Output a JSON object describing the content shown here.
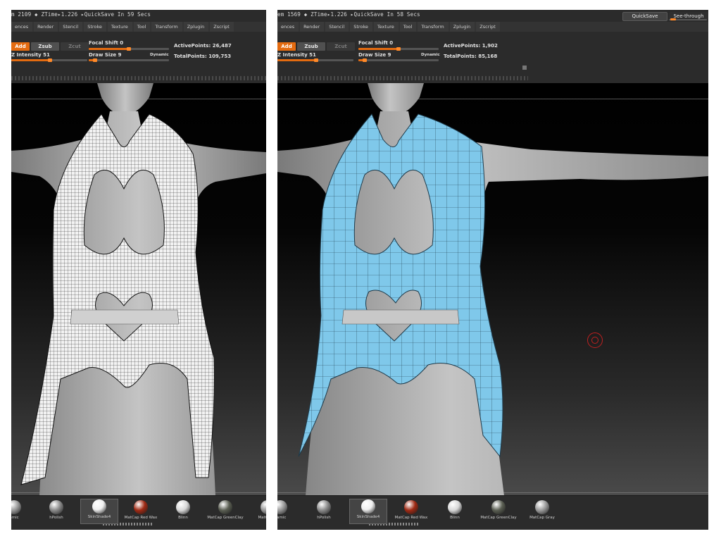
{
  "left_panel": {
    "status": "m 2109 ◆ ZTime▸1.226 ▸QuickSave In 59 Secs",
    "menu": [
      "ences",
      "Render",
      "Stencil",
      "Stroke",
      "Texture",
      "Tool",
      "Transform",
      "Zplugin",
      "Zscript"
    ],
    "modes": {
      "add": "Add",
      "zsub": "Zsub",
      "zcut": "Zcut"
    },
    "z_intensity_label": "Z Intensity 51",
    "focal_shift_label": "Focal Shift 0",
    "draw_size_label": "Draw Size 9",
    "dynamic_label": "Dynamic",
    "active_points_label": "ActivePoints: 26,487",
    "total_points_label": "TotalPoints: 109,753",
    "z_intensity_fraction": 0.51,
    "focal_shift_fraction": 0.5,
    "draw_size_fraction": 0.08,
    "materials": [
      {
        "label": "amic",
        "color": "#9a9a9a",
        "icon": "material-sphere-icon"
      },
      {
        "label": "hPolish",
        "color": "#8a8a8a",
        "icon": "material-sphere-icon"
      },
      {
        "label": "SkinShade4",
        "color": "#f0f0f0",
        "icon": "material-sphere-icon",
        "selected": true
      },
      {
        "label": "MatCap Red Wax",
        "color": "#a02a14",
        "icon": "material-sphere-icon"
      },
      {
        "label": "Blinn",
        "color": "#d8d8d8",
        "icon": "material-sphere-icon"
      },
      {
        "label": "MatCap GreenClay",
        "color": "#5a5e52",
        "icon": "material-sphere-icon"
      },
      {
        "label": "MatCap G",
        "color": "#9a9a9a",
        "icon": "material-sphere-icon"
      }
    ]
  },
  "right_panel": {
    "status": "em 1569 ◆ ZTime▸1.226 ▸QuickSave In 58 Secs",
    "menu": [
      "ences",
      "Render",
      "Stencil",
      "Stroke",
      "Texture",
      "Tool",
      "Transform",
      "Zplugin",
      "Zscript"
    ],
    "quicksave_label": "QuickSave",
    "see_through_label": "See-through",
    "see_through_fraction": 0.1,
    "modes": {
      "add": "Add",
      "zsub": "Zsub",
      "zcut": "Zcut"
    },
    "z_intensity_label": "Z Intensity 51",
    "focal_shift_label": "Focal Shift 0",
    "draw_size_label": "Draw Size 9",
    "dynamic_label": "Dynamic",
    "active_points_label": "ActivePoints: 1,902",
    "total_points_label": "TotalPoints: 85,168",
    "z_intensity_fraction": 0.51,
    "focal_shift_fraction": 0.5,
    "draw_size_fraction": 0.08,
    "materials": [
      {
        "label": "namic",
        "color": "#9a9a9a",
        "icon": "material-sphere-icon"
      },
      {
        "label": "hPolish",
        "color": "#8a8a8a",
        "icon": "material-sphere-icon"
      },
      {
        "label": "SkinShade4",
        "color": "#f0f0f0",
        "icon": "material-sphere-icon",
        "selected": true
      },
      {
        "label": "MatCap Red Wax",
        "color": "#a02a14",
        "icon": "material-sphere-icon"
      },
      {
        "label": "Blinn",
        "color": "#d8d8d8",
        "icon": "material-sphere-icon"
      },
      {
        "label": "MatCap GreenClay",
        "color": "#5a5e52",
        "icon": "material-sphere-icon"
      },
      {
        "label": "MatCap Gray",
        "color": "#9a9a9a",
        "icon": "material-sphere-icon"
      }
    ]
  },
  "colors": {
    "accent": "#e46b10",
    "panel_bg": "#2b2b2b",
    "mesh_wire_left": "#f2f2f2",
    "mesh_fill_right": "#7fc8ea",
    "skin": "#b8b8b8",
    "brush_cursor": "#c02020"
  }
}
